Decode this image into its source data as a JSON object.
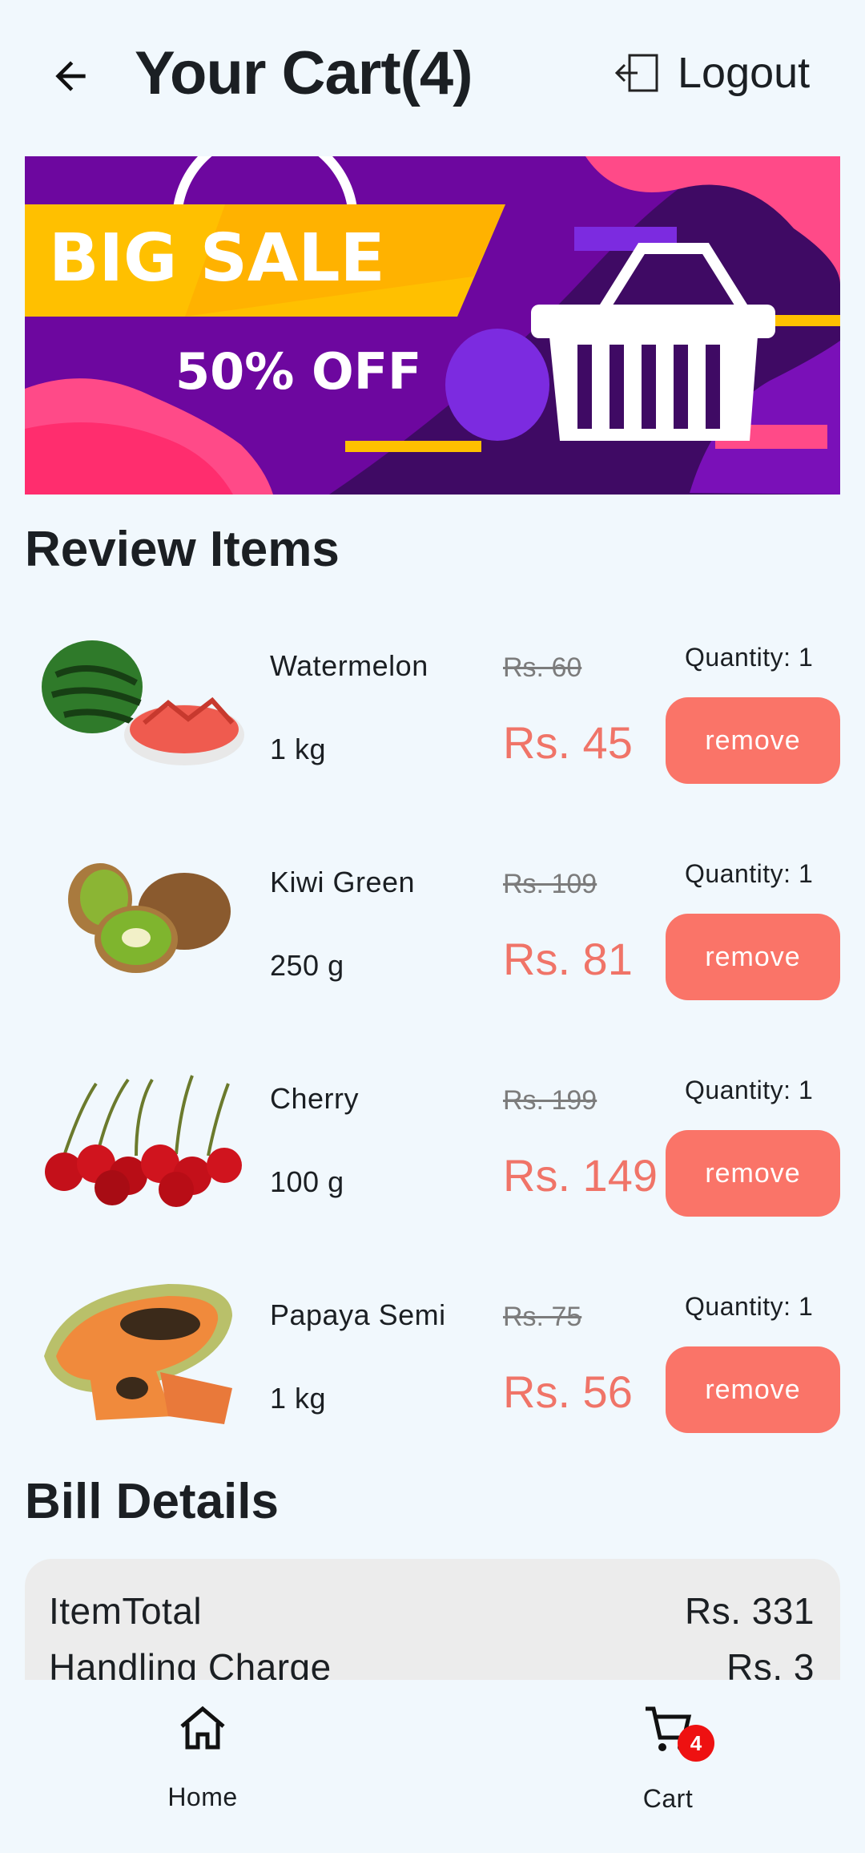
{
  "header": {
    "title": "Your Cart(4)",
    "logout_label": "Logout"
  },
  "banner": {
    "headline": "BIG SALE",
    "subline": "50% OFF"
  },
  "review_title": "Review Items",
  "items": [
    {
      "name": "Watermelon",
      "unit": "1 kg",
      "old_price": "Rs. 60",
      "new_price": "Rs. 45",
      "quantity": "Quantity: 1",
      "remove_label": "remove"
    },
    {
      "name": "Kiwi Green",
      "unit": "250 g",
      "old_price": "Rs. 109",
      "new_price": "Rs. 81",
      "quantity": "Quantity: 1",
      "remove_label": "remove"
    },
    {
      "name": "Cherry",
      "unit": "100 g",
      "old_price": "Rs. 199",
      "new_price": "Rs. 149",
      "quantity": "Quantity: 1",
      "remove_label": "remove"
    },
    {
      "name": "Papaya Semi",
      "unit": "1 kg",
      "old_price": "Rs. 75",
      "new_price": "Rs. 56",
      "quantity": "Quantity: 1",
      "remove_label": "remove"
    }
  ],
  "bill": {
    "title": "Bill Details",
    "rows": [
      {
        "label": "ItemTotal",
        "value": "Rs. 331"
      },
      {
        "label": "Handling Charge",
        "value": "Rs. 3"
      }
    ]
  },
  "nav": {
    "home_label": "Home",
    "cart_label": "Cart",
    "cart_badge": "4"
  },
  "colors": {
    "accent": "#fa7468",
    "price": "#f07468",
    "background": "#f1f8fd",
    "badge": "#ee1111"
  },
  "icons": [
    "back-arrow-icon",
    "logout-icon",
    "home-icon",
    "cart-icon"
  ]
}
